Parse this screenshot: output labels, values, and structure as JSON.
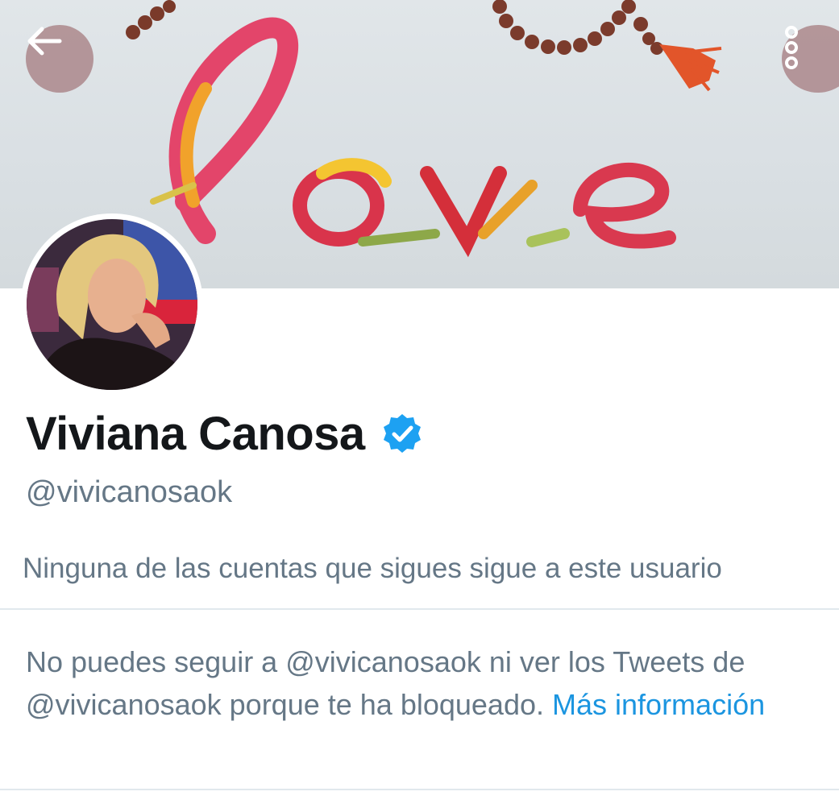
{
  "header": {
    "back_icon": "arrow-left-icon",
    "more_icon": "more-vertical-icon",
    "banner_word": "love"
  },
  "profile": {
    "display_name": "Viviana Canosa",
    "verified": true,
    "verified_icon": "verified-badge-icon",
    "handle": "@vivicanosaok",
    "followers_you_know": "Ninguna de las cuentas que sigues sigue a este usuario"
  },
  "blocked_notice": {
    "message": "No puedes seguir a @vivicanosaok ni ver los Tweets de @vivicanosaok porque te ha bloqueado.",
    "link_label": "Más información"
  },
  "colors": {
    "primary_text": "#14171a",
    "secondary_text": "#657786",
    "link": "#1b95e0",
    "verified": "#1da1f2",
    "divider": "#e1e8ed"
  }
}
